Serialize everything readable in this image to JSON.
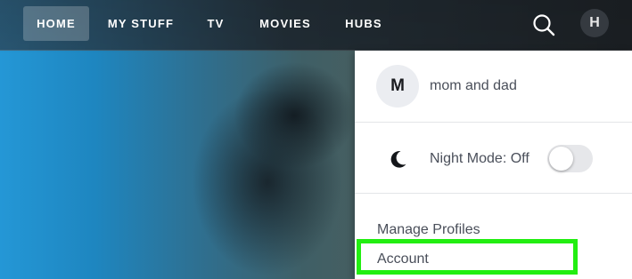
{
  "nav": {
    "items": [
      {
        "label": "HOME",
        "active": true
      },
      {
        "label": "MY STUFF",
        "active": false
      },
      {
        "label": "TV",
        "active": false
      },
      {
        "label": "MOVIES",
        "active": false
      },
      {
        "label": "HUBS",
        "active": false
      }
    ],
    "search_icon": "search-icon",
    "user_initial": "H"
  },
  "dropdown": {
    "profile": {
      "initial": "M",
      "name": "mom and dad"
    },
    "night_mode": {
      "icon": "moon-icon",
      "label": "Night Mode: Off",
      "enabled": false
    },
    "links": [
      "Manage Profiles",
      "Account"
    ]
  },
  "colors": {
    "highlight": "#22ee11",
    "hero_accent": "#2497d6"
  }
}
